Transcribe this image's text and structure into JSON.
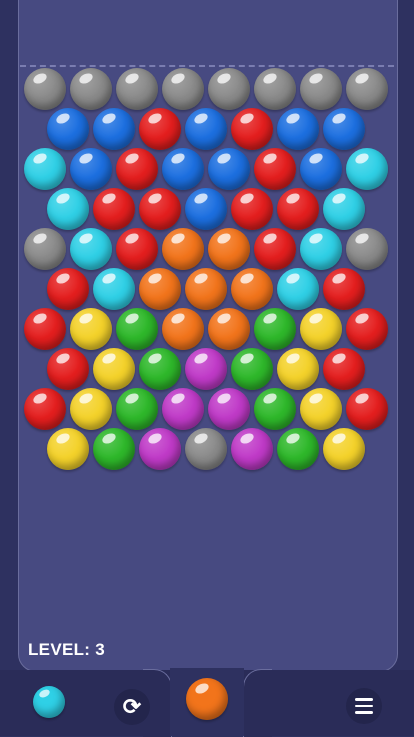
{
  "level_label": "LEVEL: 3",
  "colors": {
    "gray": "#8a8a8a",
    "blue": "#1c6fe0",
    "red": "#e41e1e",
    "cyan": "#2fd0e6",
    "orange": "#f2741b",
    "yellow": "#f4d22a",
    "green": "#2eb82a",
    "purple": "#c03ac8"
  },
  "grid": [
    [
      "gray",
      "gray",
      "gray",
      "gray",
      "gray",
      "gray",
      "gray",
      "gray"
    ],
    [
      "blue",
      "blue",
      "red",
      "blue",
      "red",
      "blue",
      "blue"
    ],
    [
      "cyan",
      "blue",
      "red",
      "blue",
      "blue",
      "red",
      "blue",
      "cyan"
    ],
    [
      "cyan",
      "red",
      "red",
      "blue",
      "red",
      "red",
      "cyan"
    ],
    [
      "gray",
      "cyan",
      "red",
      "orange",
      "orange",
      "red",
      "cyan",
      "gray"
    ],
    [
      "red",
      "cyan",
      "orange",
      "orange",
      "orange",
      "cyan",
      "red"
    ],
    [
      "red",
      "yellow",
      "green",
      "orange",
      "orange",
      "green",
      "yellow",
      "red"
    ],
    [
      "red",
      "yellow",
      "green",
      "purple",
      "green",
      "yellow",
      "red"
    ],
    [
      "red",
      "yellow",
      "green",
      "purple",
      "purple",
      "green",
      "yellow",
      "red"
    ],
    [
      "yellow",
      "green",
      "purple",
      "gray",
      "purple",
      "green",
      "yellow"
    ]
  ],
  "next_bubble": "cyan",
  "current_bubble": "orange",
  "icons": {
    "swap": "swap-arrows-icon",
    "menu": "hamburger-menu-icon"
  }
}
